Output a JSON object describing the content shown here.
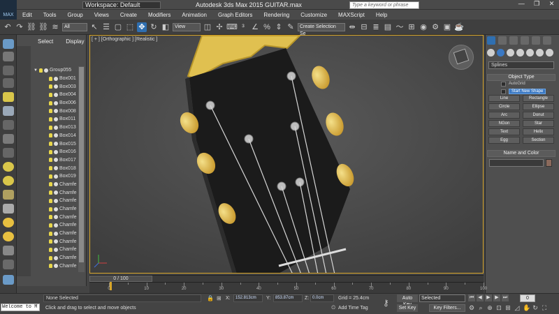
{
  "title_bar": {
    "app_logo": "MAX",
    "workspace": "Workspace: Default",
    "app_title": "Autodesk 3ds Max  2015      GUITAR.max",
    "search_placeholder": "Type a keyword or phrase",
    "window_buttons": [
      "—",
      "❐",
      "✕"
    ]
  },
  "menu": [
    "Edit",
    "Tools",
    "Group",
    "Views",
    "Create",
    "Modifiers",
    "Animation",
    "Graph Editors",
    "Rendering",
    "Customize",
    "MAXScript",
    "Help"
  ],
  "toolbar": {
    "selection_filter": "All",
    "reference_coord": "View",
    "named_selection": "Create Selection Se"
  },
  "scene_explorer": {
    "tabs": [
      "Select",
      "Display"
    ],
    "items": [
      {
        "label": "Group055",
        "type": "group"
      },
      {
        "label": "Box001",
        "type": "box"
      },
      {
        "label": "Box003",
        "type": "box"
      },
      {
        "label": "Box004",
        "type": "box"
      },
      {
        "label": "Box006",
        "type": "box"
      },
      {
        "label": "Box008",
        "type": "box"
      },
      {
        "label": "Box011",
        "type": "box"
      },
      {
        "label": "Box013",
        "type": "box"
      },
      {
        "label": "Box014",
        "type": "box"
      },
      {
        "label": "Box015",
        "type": "box"
      },
      {
        "label": "Box016",
        "type": "box"
      },
      {
        "label": "Box017",
        "type": "box"
      },
      {
        "label": "Box018",
        "type": "box"
      },
      {
        "label": "Box019",
        "type": "box"
      },
      {
        "label": "Chamfe",
        "type": "box"
      },
      {
        "label": "Chamfe",
        "type": "box"
      },
      {
        "label": "Chamfe",
        "type": "box"
      },
      {
        "label": "Chamfe",
        "type": "box"
      },
      {
        "label": "Chamfe",
        "type": "box"
      },
      {
        "label": "Chamfe",
        "type": "box"
      },
      {
        "label": "Chamfe",
        "type": "box"
      },
      {
        "label": "Chamfe",
        "type": "box"
      },
      {
        "label": "Chamfe",
        "type": "box"
      },
      {
        "label": "Chamfe",
        "type": "box"
      },
      {
        "label": "Chamfe",
        "type": "box"
      }
    ]
  },
  "viewport": {
    "label": "[ + ] [Orthographic ] [Realistic ]"
  },
  "command_panel": {
    "category_dropdown": "Splines",
    "object_type_header": "Object Type",
    "autogrid_label": "AutoGrid",
    "start_new_shape_label": "Start New Shape",
    "shape_buttons": [
      "Line",
      "Rectangle",
      "Circle",
      "Ellipse",
      "Arc",
      "Donut",
      "NGon",
      "Star",
      "Text",
      "Helix",
      "Egg",
      "Section"
    ],
    "name_color_header": "Name and Color",
    "object_color": "#8b6a5c"
  },
  "timeline": {
    "time_slider_label": "0 / 100",
    "ruler_labels": [
      "0",
      "10",
      "20",
      "30",
      "40",
      "50",
      "60",
      "70",
      "80",
      "90",
      "100"
    ],
    "current_frame": 0,
    "total_frames": 100
  },
  "status": {
    "maxscript_listener": "Welcome to M",
    "selection_status": "None Selected",
    "prompt": "Click and drag to select and move objects",
    "x_label": "X:",
    "x_value": "152.813cm",
    "y_label": "Y:",
    "y_value": "853.87cm",
    "z_label": "Z:",
    "z_value": "0.0cm",
    "grid": "Grid = 25.4cm",
    "add_time_tag": "Add Time Tag",
    "auto_key": "Auto Key",
    "set_key": "Set Key",
    "key_mode": "Selected",
    "key_filters": "Key Filters...",
    "frame": "0"
  },
  "colors": {
    "accent_blue": "#2f6fb0",
    "viewport_border": "#d8a62a",
    "tuning_peg": "#d9b54a",
    "headstock": "#1b1b1b"
  }
}
